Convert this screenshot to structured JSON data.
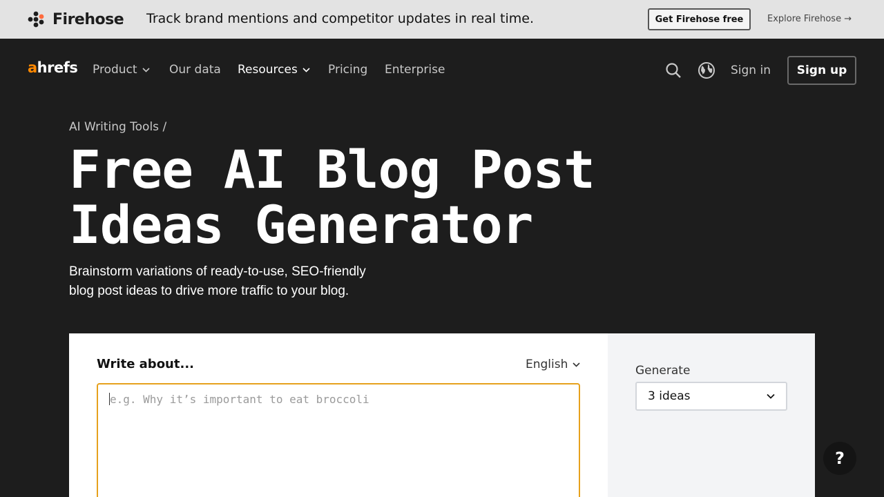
{
  "promo": {
    "brand": "Firehose",
    "text": "Track brand mentions and competitor updates in real time.",
    "cta": "Get Firehose free",
    "link": "Explore Firehose →"
  },
  "nav": {
    "brand_a": "a",
    "brand_rest": "hrefs",
    "items": [
      {
        "label": "Product"
      },
      {
        "label": "Our data"
      },
      {
        "label": "Resources"
      },
      {
        "label": "Pricing"
      },
      {
        "label": "Enterprise"
      }
    ],
    "sign_in": "Sign in",
    "sign_up": "Sign up"
  },
  "hero": {
    "breadcrumb": "AI Writing Tools /",
    "title": "Free AI Blog Post Ideas Generator",
    "subtitle": "Brainstorm variations of ready-to-use, SEO-friendly blog post ideas to drive more traffic to your blog."
  },
  "tool": {
    "write_label": "Write about...",
    "language": "English",
    "input_value": "",
    "input_placeholder": "e.g. Why it’s important to eat broccoli",
    "generate_label": "Generate",
    "generate_selected": "3 ideas"
  },
  "help": {
    "label": "?"
  },
  "colors": {
    "background": "#1d1d1d",
    "promo_bg": "#e3e3e3",
    "accent_orange": "#ff8800",
    "input_border": "#e6a11c",
    "side_panel": "#f3f4f6"
  }
}
